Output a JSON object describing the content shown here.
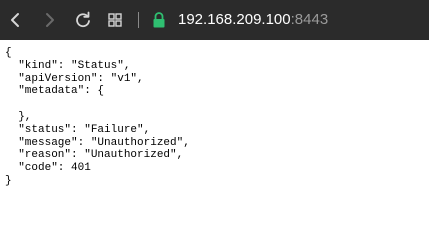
{
  "toolbar": {
    "url_host": "192.168.209.100",
    "url_port": ":8443",
    "colors": {
      "background": "#2b2b2b",
      "secure_lock": "#2fbf71"
    },
    "icons": [
      "back-arrow-icon",
      "forward-arrow-icon",
      "reload-icon",
      "apps-grid-icon",
      "lock-icon"
    ]
  },
  "content": {
    "lines": [
      "{",
      "  \"kind\": \"Status\",",
      "  \"apiVersion\": \"v1\",",
      "  \"metadata\": {",
      "",
      "  },",
      "  \"status\": \"Failure\",",
      "  \"message\": \"Unauthorized\",",
      "  \"reason\": \"Unauthorized\",",
      "  \"code\": 401",
      "}"
    ]
  }
}
